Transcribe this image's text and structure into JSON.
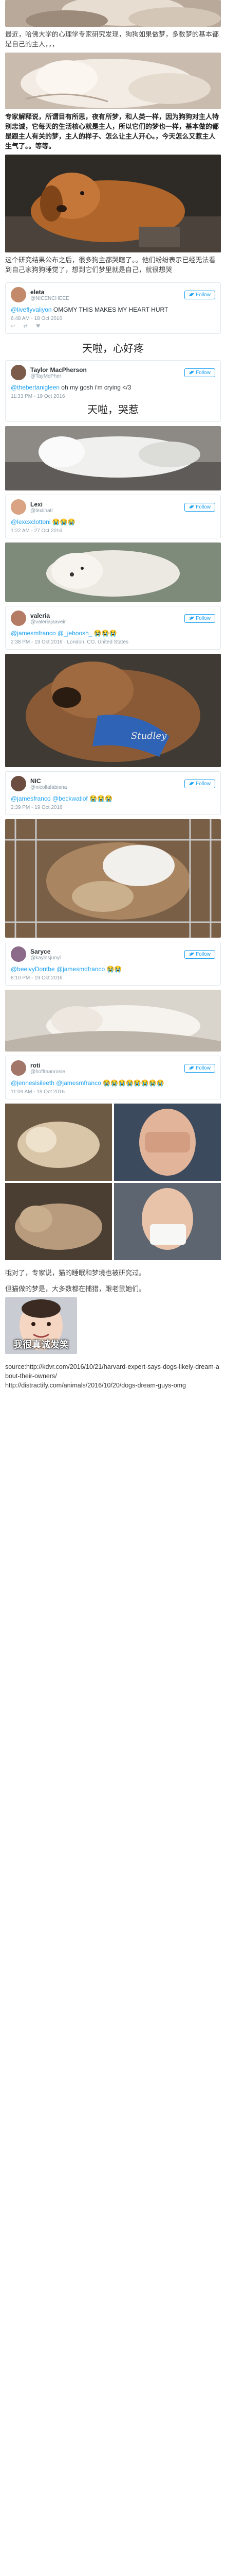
{
  "intro": "最近，哈佛大学的心理学专家研究发现，狗狗如果做梦，多数梦的基本都是自己的主人，，，",
  "expert_para": "专家解释说，所谓目有所思，夜有所梦，和人类一样，因为狗狗对主人特别忠诚，它每天的生活核心就是主人，所以它们的梦也一样，基本做的都是跟主人有关的梦，主人的样子、怎么让主人开心。，今天怎么又惹主人生气了。。等等。",
  "after_news": "这个研究结果公布之后，很多狗主都哭瞎了。。他们纷纷表示已经无法看到自己家狗狗睡觉了，想到它们梦里就是自己，就很想哭",
  "tweets": [
    {
      "name": "eleta",
      "handle": "@NICENCHEEE",
      "follow": "Follow",
      "mention": "@liveflyvaliyon",
      "text": "OMGMY THIS MAKES MY HEART HURT",
      "meta": "6:48 AM - 18 Oct 2016",
      "translation": "天啦，心好疼"
    },
    {
      "name": "Taylor MacPherson",
      "handle": "@TayMcPher",
      "follow": "Follow",
      "mention": "@thebertanigleen",
      "text": "oh my gosh i'm crying </3",
      "meta": "11:33 PM - 19 Oct 2016",
      "translation": "天啦，哭惹"
    },
    {
      "name": "Lexi",
      "handle": "@lexiinatl",
      "follow": "Follow",
      "mention": "@lexcxclottoni",
      "text": "😭😭😭",
      "meta": "1:22 AM - 27 Oct 2016",
      "translation": ""
    },
    {
      "name": "valeria",
      "handle": "@valeriajaaveir",
      "follow": "Follow",
      "mention": "@jamesmfranco @_jeboosh_",
      "text": "😭😭😭",
      "meta": "2:38 PM - 19 Oct 2016 · London, CO, United States",
      "translation": ""
    },
    {
      "name": "NIC",
      "handle": "@nicollafabiana",
      "follow": "Follow",
      "mention": "@jamesfranco @beckwatlof",
      "text": "😭😭😭",
      "meta": "2:39 PM - 19 Oct 2016",
      "translation": ""
    },
    {
      "name": "Saryce",
      "handle": "@kayinsjunyl",
      "follow": "Follow",
      "mention": "@beelvyDontbe @jamesmdfranco",
      "text": "😭😭",
      "meta": "8:10 PM - 19 Oct 2016",
      "translation": ""
    },
    {
      "name": "roti",
      "handle": "@hoffmanrosie",
      "follow": "Follow",
      "mention": "@jennesisileeth @jamesmfranco",
      "text": "😭😭😭😭😭😭😭😭",
      "meta": "11:09 AM - 19 Oct 2016",
      "translation": ""
    }
  ],
  "photo1_caption": "",
  "closing1": "哦对了，专家说，猫的睡眠和梦境也被研究过。",
  "closing2": "但猫做的梦是，大多数都在捕猎，跟老鼠她们。",
  "baby_caption": "我很真诚发笑",
  "source_lines": [
    "source:http://kdvr.com/2016/10/21/harvard-expert-says-dogs-likely-dream-about-their-owners/",
    "http://distractify.com/animals/2016/10/20/dogs-dream-guys-omg"
  ],
  "colors": {
    "twitter_blue": "#1da1f2",
    "emoji": "#f5c33b"
  }
}
